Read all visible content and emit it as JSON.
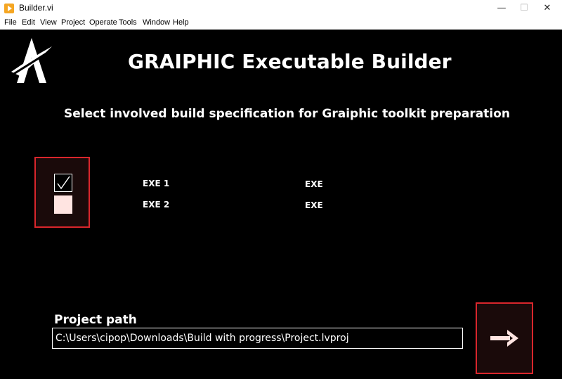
{
  "window": {
    "title": "Builder.vi",
    "minimize": "—",
    "maximize": "☐",
    "close": "✕"
  },
  "menu": [
    "File",
    "Edit",
    "View",
    "Project",
    "Operate",
    "Tools",
    "Window",
    "Help"
  ],
  "main": {
    "title": "GRAIPHIC Executable Builder",
    "subtitle": "Select involved build specification for Graiphic toolkit preparation",
    "build_specs": [
      {
        "name": "EXE 1",
        "type": "EXE",
        "checked": true
      },
      {
        "name": "EXE 2",
        "type": "EXE",
        "checked": false
      }
    ],
    "project_path_label": "Project path",
    "project_path_value": "C:\\Users\\cipop\\Downloads\\Build with progress\\Project.lvproj"
  },
  "colors": {
    "background": "#000000",
    "accent_border": "#d9262c",
    "text": "#ffffff",
    "checkbox_unchecked": "#ffe4e1",
    "arrow": "#ffe4e1"
  },
  "icons": {
    "app": "labview-vi-icon",
    "logo": "graiphic-logo-icon",
    "next": "arrow-right-icon"
  }
}
